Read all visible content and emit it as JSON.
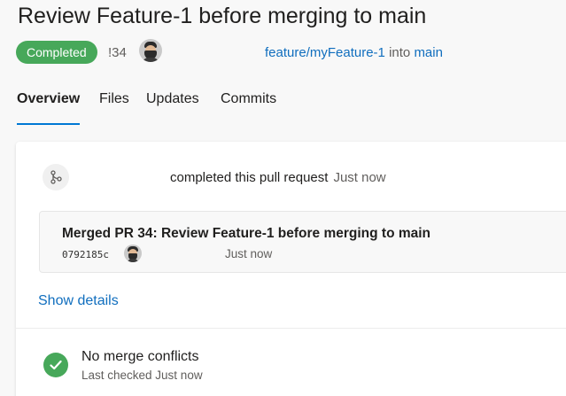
{
  "header": {
    "title": "Review Feature-1 before merging to main",
    "status_badge": "Completed",
    "pr_id": "!34",
    "source_branch": "feature/myFeature-1",
    "into_text": "into",
    "target_branch": "main"
  },
  "tabs": [
    {
      "label": "Overview",
      "active": true
    },
    {
      "label": "Files",
      "active": false
    },
    {
      "label": "Updates",
      "active": false
    },
    {
      "label": "Commits",
      "active": false
    }
  ],
  "activity": {
    "event_text": "completed this pull request",
    "event_time": "Just now",
    "commit": {
      "title": "Merged PR 34: Review Feature-1 before merging to main",
      "hash": "0792185c",
      "time": "Just now"
    },
    "show_details": "Show details"
  },
  "merge_status": {
    "title": "No merge conflicts",
    "subtitle": "Last checked Just now"
  },
  "colors": {
    "accent": "#0078d4",
    "link": "#106ebe",
    "success": "#47a85a"
  },
  "icons": [
    "avatar",
    "pull-request-merge-icon",
    "check-icon"
  ]
}
